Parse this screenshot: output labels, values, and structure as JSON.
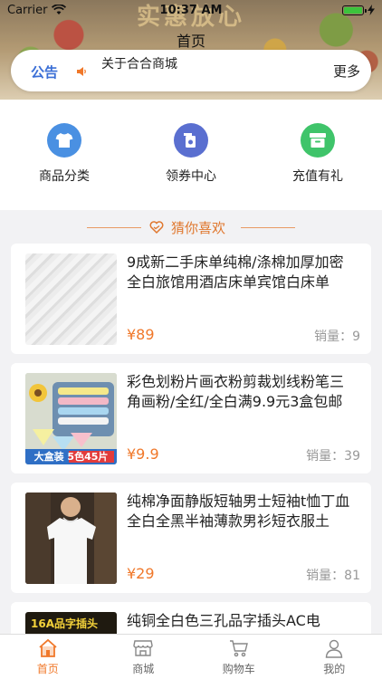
{
  "status_bar": {
    "carrier": "Carrier",
    "time": "10:37 AM",
    "battery_level": 1.0
  },
  "hero": {
    "banner_text": "实惠放心"
  },
  "nav": {
    "title": "首页"
  },
  "notice": {
    "tag": "公告",
    "text": "关于合合商城",
    "more": "更多"
  },
  "quick": {
    "items": [
      {
        "label": "商品分类",
        "icon": "tshirt-icon",
        "color": "#4a90e2"
      },
      {
        "label": "领券中心",
        "icon": "coupon-icon",
        "color": "#5a6fd0"
      },
      {
        "label": "充值有礼",
        "icon": "gift-box-icon",
        "color": "#3fc46a"
      }
    ]
  },
  "section": {
    "title": "猜你喜欢",
    "accent": "#e0782f"
  },
  "products": [
    {
      "title": "9成新二手床单纯棉/涤棉加厚加密全白旅馆用酒店床单宾馆白床单",
      "price": "¥89",
      "sales": "销量：9"
    },
    {
      "title": "彩色划粉片画衣粉剪裁划线粉笔三角画粉/全红/全白满9.9元3盒包邮",
      "price": "¥9.9",
      "sales": "销量：39",
      "image_badge": "大盒装 5色45片"
    },
    {
      "title": "纯棉净面静版短轴男士短袖t恤丁血全白全黑半袖薄款男衫短衣服土",
      "price": "¥29",
      "sales": "销量：81"
    },
    {
      "title": "纯铜全白色三孔品字插头AC电",
      "image_badge": "16A品字插头"
    }
  ],
  "tabbar": {
    "items": [
      {
        "label": "首页",
        "icon": "home-icon",
        "active": true
      },
      {
        "label": "商城",
        "icon": "store-icon",
        "active": false
      },
      {
        "label": "购物车",
        "icon": "cart-icon",
        "active": false
      },
      {
        "label": "我的",
        "icon": "user-icon",
        "active": false
      }
    ],
    "active_color": "#f0782a"
  }
}
